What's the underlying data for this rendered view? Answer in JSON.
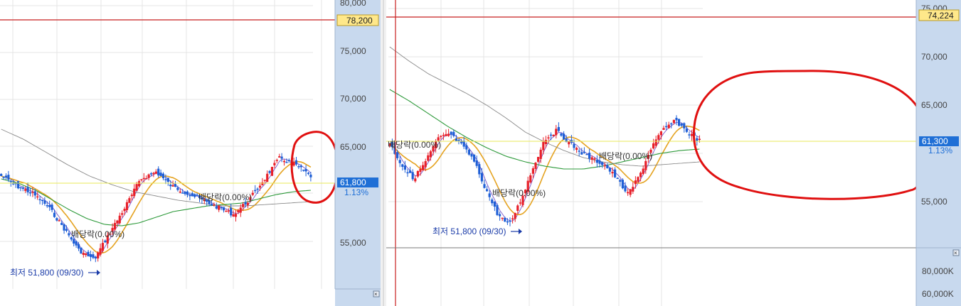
{
  "colors": {
    "up_candle": "#e8202a",
    "down_candle": "#1f5fd6",
    "ma_short": "#7a55c9",
    "ma_mid": "#e5a321",
    "ma_long": "#2e9a3b",
    "ma_longest": "#8a8a8a",
    "ref_line": "#e8e85a",
    "limit_line": "#c81e1e",
    "axis_bg": "#c8d9ee",
    "grid": "#e4e4e4",
    "price_label_bg": "#ffe88a",
    "current_label_bg": "#1f6fd6",
    "annotation_circle": "#e01010",
    "low_text": "#1a3ba8"
  },
  "left_chart": {
    "y_ticks": [
      "80,000",
      "75,000",
      "70,000",
      "65,000",
      "55,000"
    ],
    "high_label": "78,200",
    "current_label": "61,800",
    "change_pct": "1.13%",
    "low_marker": "최저 51,800 (09/30)",
    "limit_tag_1": "배당락(0.00%)",
    "limit_tag_2": "배당락(0.00%)",
    "close_icon": "close-icon"
  },
  "right_chart": {
    "y_ticks": [
      "75,000",
      "70,000",
      "65,000",
      "55,000"
    ],
    "high_label": "74,224",
    "current_label": "61,300",
    "change_pct": "1.13%",
    "volume_ticks": [
      "80,000K",
      "60,000K"
    ],
    "low_marker": "최저 51,800 (09/30)",
    "limit_tag_1": "배당락(0.00%)",
    "limit_tag_2": "배당락(0.00%)",
    "limit_tag_3": "배당락(0.00%)",
    "close_icon": "close-icon"
  }
}
